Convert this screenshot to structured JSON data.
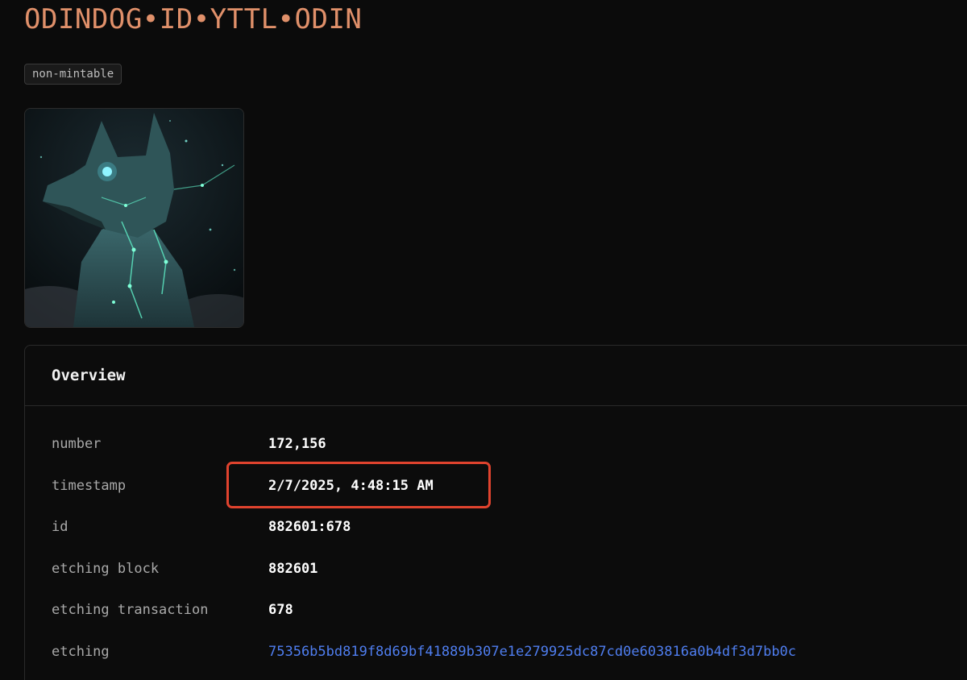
{
  "rune": {
    "name": "ODINDOG•ID•YTTL•ODIN",
    "badge": "non-mintable",
    "image": "wolf-artwork"
  },
  "overview": {
    "title": "Overview",
    "rows": [
      {
        "label": "number",
        "value": "172,156"
      },
      {
        "label": "timestamp",
        "value": "2/7/2025, 4:48:15 AM"
      },
      {
        "label": "id",
        "value": "882601:678"
      },
      {
        "label": "etching block",
        "value": "882601"
      },
      {
        "label": "etching transaction",
        "value": "678"
      },
      {
        "label": "etching",
        "value": "75356b5bd819f8d69bf41889b307e1e279925dc87cd0e603816a0b4df3d7bb0c"
      }
    ]
  },
  "colors": {
    "title": "#e0906a",
    "link": "#4f7ef0",
    "highlight": "#e0432e",
    "background": "#0b0b0b"
  }
}
